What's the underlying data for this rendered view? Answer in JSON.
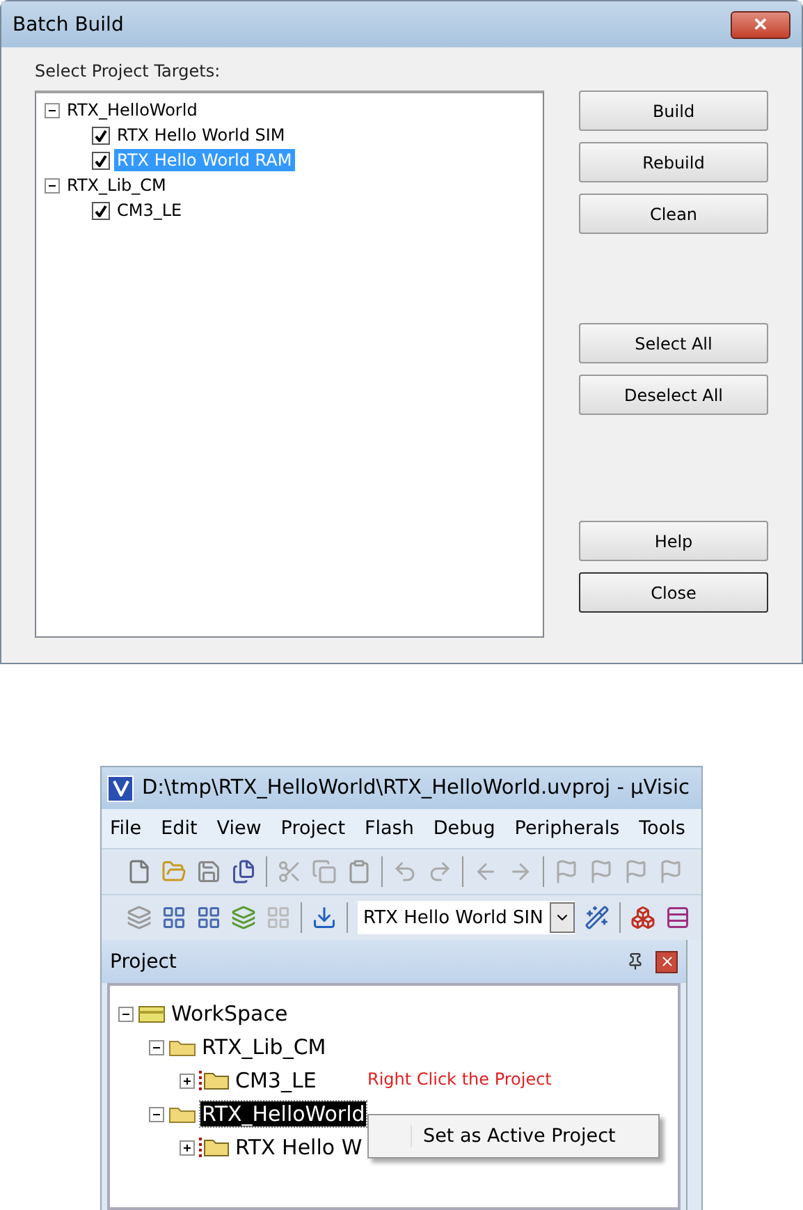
{
  "batch_dialog": {
    "title": "Batch Build",
    "close": "✕",
    "label": "Select Project Targets:",
    "tree": [
      {
        "label": "RTX_HelloWorld",
        "expanded": true,
        "children": [
          {
            "label": "RTX Hello World SIM",
            "checked": true,
            "selected": false
          },
          {
            "label": "RTX Hello World RAM",
            "checked": true,
            "selected": true
          }
        ]
      },
      {
        "label": "RTX_Lib_CM",
        "expanded": true,
        "children": [
          {
            "label": "CM3_LE",
            "checked": true,
            "selected": false
          }
        ]
      }
    ],
    "button_groups": [
      [
        {
          "label": "Build",
          "focused": false
        },
        {
          "label": "Rebuild",
          "focused": false
        },
        {
          "label": "Clean",
          "focused": false
        }
      ],
      [
        {
          "label": "Select All",
          "focused": false
        },
        {
          "label": "Deselect All",
          "focused": false
        }
      ],
      [
        {
          "label": "Help",
          "focused": false
        },
        {
          "label": "Close",
          "focused": true
        }
      ]
    ]
  },
  "uvision": {
    "title": "D:\\tmp\\RTX_HelloWorld\\RTX_HelloWorld.uvproj - µVisic",
    "menu": [
      "File",
      "Edit",
      "View",
      "Project",
      "Flash",
      "Debug",
      "Peripherals",
      "Tools"
    ],
    "target_select": {
      "value": "RTX Hello World SIN"
    },
    "panel_title": "Project",
    "tree": [
      {
        "label": "WorkSpace",
        "kind": "workspace",
        "expanded": true,
        "selected": false,
        "children": [
          {
            "label": "RTX_Lib_CM",
            "kind": "project",
            "expanded": true,
            "selected": false,
            "children": [
              {
                "label": "CM3_LE",
                "kind": "target",
                "expanded": false,
                "selected": false
              }
            ]
          },
          {
            "label": "RTX_HelloWorld",
            "kind": "project",
            "expanded": true,
            "selected": true,
            "children": [
              {
                "label": "RTX Hello W",
                "kind": "target",
                "expanded": false,
                "selected": false
              }
            ]
          }
        ]
      }
    ],
    "annotation": "Right Click the Project",
    "context_menu": [
      "Set as Active Project"
    ]
  }
}
